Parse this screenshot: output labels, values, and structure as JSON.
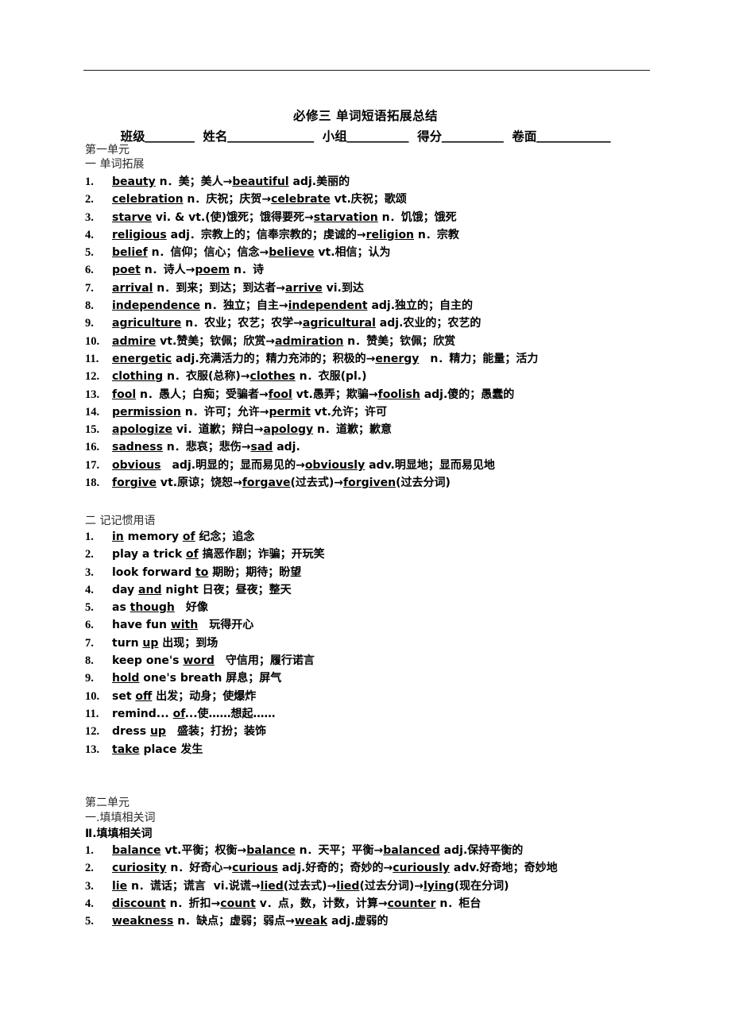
{
  "document": {
    "title": "必修三 单词短语拓展总结",
    "blanks_line": [
      {
        "label": "班级",
        "blank": "＿＿＿＿"
      },
      {
        "label": "姓名",
        "blank": "＿＿＿＿＿＿＿"
      },
      {
        "label": "小组",
        "blank": "＿＿＿＿＿"
      },
      {
        "label": "得分",
        "blank": "＿＿＿＿＿"
      },
      {
        "label": "卷面",
        "blank": "＿＿＿＿＿＿"
      }
    ]
  },
  "unit_one": {
    "heading": "第一单元",
    "section_one_heading": "一 单词拓展",
    "word_items": [
      {
        "n": "1.",
        "parts": [
          {
            "t": "beauty",
            "u": true
          },
          {
            "t": " n．美；美人→",
            "u": false
          },
          {
            "t": "beautiful",
            "u": true
          },
          {
            "t": " adj.美丽的",
            "u": false
          }
        ]
      },
      {
        "n": "2.",
        "parts": [
          {
            "t": "celebration",
            "u": true
          },
          {
            "t": " n．庆祝；庆贺→",
            "u": false
          },
          {
            "t": "celebrate",
            "u": true
          },
          {
            "t": " vt.庆祝；歌颂",
            "u": false
          }
        ]
      },
      {
        "n": "3.",
        "parts": [
          {
            "t": "starve",
            "u": true
          },
          {
            "t": " vi. & vt.(使)饿死；饿得要死→",
            "u": false
          },
          {
            "t": "starvation",
            "u": true
          },
          {
            "t": " n．饥饿；饿死",
            "u": false
          }
        ]
      },
      {
        "n": "4.",
        "parts": [
          {
            "t": "religious",
            "u": true
          },
          {
            "t": " adj．宗教上的；信奉宗教的；虔诚的→",
            "u": false
          },
          {
            "t": "religion",
            "u": true
          },
          {
            "t": " n．宗教",
            "u": false
          }
        ]
      },
      {
        "n": "5.",
        "parts": [
          {
            "t": "belief",
            "u": true
          },
          {
            "t": " n．信仰；信心；信念→",
            "u": false
          },
          {
            "t": "believe",
            "u": true
          },
          {
            "t": " vt.相信；认为",
            "u": false
          }
        ]
      },
      {
        "n": "6.",
        "parts": [
          {
            "t": "poet",
            "u": true
          },
          {
            "t": " n．诗人→",
            "u": false
          },
          {
            "t": "poem",
            "u": true
          },
          {
            "t": " n．诗",
            "u": false
          }
        ]
      },
      {
        "n": "7.",
        "parts": [
          {
            "t": "arrival",
            "u": true
          },
          {
            "t": " n．到来；到达；到达者→",
            "u": false
          },
          {
            "t": "arrive",
            "u": true
          },
          {
            "t": " vi.到达",
            "u": false
          }
        ]
      },
      {
        "n": "8.",
        "parts": [
          {
            "t": "independence",
            "u": true
          },
          {
            "t": " n．独立；自主→",
            "u": false
          },
          {
            "t": "independent",
            "u": true
          },
          {
            "t": " adj.独立的；自主的",
            "u": false
          }
        ]
      },
      {
        "n": "9.",
        "parts": [
          {
            "t": "agriculture",
            "u": true
          },
          {
            "t": " n．农业；农艺；农学→",
            "u": false
          },
          {
            "t": "agricultural",
            "u": true
          },
          {
            "t": " adj.农业的；农艺的",
            "u": false
          }
        ]
      },
      {
        "n": "10.",
        "parts": [
          {
            "t": "admire",
            "u": true
          },
          {
            "t": " vt.赞美；钦佩；欣赏→",
            "u": false
          },
          {
            "t": "admiration",
            "u": true
          },
          {
            "t": " n．赞美；钦佩；欣赏",
            "u": false
          }
        ]
      },
      {
        "n": "11.",
        "parts": [
          {
            "t": "energetic",
            "u": true
          },
          {
            "t": " adj.充满活力的；精力充沛的；积极的→",
            "u": false
          },
          {
            "t": "energy",
            "u": true
          },
          {
            "t": "　n．精力；能量；活力",
            "u": false
          }
        ]
      },
      {
        "n": "12.",
        "parts": [
          {
            "t": "clothing",
            "u": true
          },
          {
            "t": " n．衣服(总称)→",
            "u": false
          },
          {
            "t": "clothes",
            "u": true
          },
          {
            "t": " n．衣服(pl.)",
            "u": false
          }
        ]
      },
      {
        "n": "13.",
        "parts": [
          {
            "t": "fool",
            "u": true
          },
          {
            "t": " n．愚人；白痴；受骗者→",
            "u": false
          },
          {
            "t": "fool",
            "u": true
          },
          {
            "t": " vt.愚弄；欺骗→",
            "u": false
          },
          {
            "t": "foolish",
            "u": true
          },
          {
            "t": " adj.傻的；愚蠢的",
            "u": false
          }
        ]
      },
      {
        "n": "14.",
        "parts": [
          {
            "t": "permission",
            "u": true
          },
          {
            "t": " n．许可；允许→",
            "u": false
          },
          {
            "t": "permit",
            "u": true
          },
          {
            "t": " vt.允许；许可",
            "u": false
          }
        ]
      },
      {
        "n": "15.",
        "parts": [
          {
            "t": "apologize",
            "u": true
          },
          {
            "t": " vi．道歉；辩白→",
            "u": false
          },
          {
            "t": "apology",
            "u": true
          },
          {
            "t": " n．道歉；歉意",
            "u": false
          }
        ]
      },
      {
        "n": "16.",
        "parts": [
          {
            "t": "sadness",
            "u": true
          },
          {
            "t": " n．悲哀；悲伤→",
            "u": false
          },
          {
            "t": "sad",
            "u": true
          },
          {
            "t": " adj.",
            "u": false
          }
        ]
      },
      {
        "n": "17.",
        "parts": [
          {
            "t": "obvious",
            "u": true
          },
          {
            "t": "　adj.明显的；显而易见的→",
            "u": false
          },
          {
            "t": "obviously",
            "u": true
          },
          {
            "t": " adv.明显地；显而易见地",
            "u": false
          }
        ]
      },
      {
        "n": "18.",
        "parts": [
          {
            "t": "forgive",
            "u": true
          },
          {
            "t": " vt.原谅；饶恕→",
            "u": false
          },
          {
            "t": "forgave",
            "u": true
          },
          {
            "t": "(过去式)→",
            "u": false
          },
          {
            "t": "forgiven",
            "u": true
          },
          {
            "t": "(过去分词)",
            "u": false
          }
        ]
      }
    ],
    "section_two_heading": "二 记记惯用语",
    "idiom_items": [
      {
        "n": "1.",
        "parts": [
          {
            "t": "in",
            "u": true
          },
          {
            "t": " memory ",
            "u": false
          },
          {
            "t": "of",
            "u": true
          },
          {
            "t": " 纪念；追念",
            "u": false
          }
        ]
      },
      {
        "n": "2.",
        "parts": [
          {
            "t": "play a trick ",
            "u": false
          },
          {
            "t": "of",
            "u": true
          },
          {
            "t": " 搞恶作剧；诈骗；开玩笑",
            "u": false
          }
        ]
      },
      {
        "n": "3.",
        "parts": [
          {
            "t": "look forward ",
            "u": false
          },
          {
            "t": "to",
            "u": true
          },
          {
            "t": " 期盼；期待；盼望",
            "u": false
          }
        ]
      },
      {
        "n": "4.",
        "parts": [
          {
            "t": "day ",
            "u": false
          },
          {
            "t": "and",
            "u": true
          },
          {
            "t": " night 日夜；昼夜；整天",
            "u": false
          }
        ]
      },
      {
        "n": "5.",
        "parts": [
          {
            "t": "as ",
            "u": false
          },
          {
            "t": "though",
            "u": true
          },
          {
            "t": "　好像",
            "u": false
          }
        ]
      },
      {
        "n": "6.",
        "parts": [
          {
            "t": "have fun ",
            "u": false
          },
          {
            "t": "with",
            "u": true
          },
          {
            "t": "　玩得开心",
            "u": false
          }
        ]
      },
      {
        "n": "7.",
        "parts": [
          {
            "t": "turn ",
            "u": false
          },
          {
            "t": "up",
            "u": true
          },
          {
            "t": " 出现；到场",
            "u": false
          }
        ]
      },
      {
        "n": "8.",
        "parts": [
          {
            "t": "keep one's ",
            "u": false
          },
          {
            "t": "word",
            "u": true
          },
          {
            "t": "　守信用；履行诺言",
            "u": false
          }
        ]
      },
      {
        "n": "9.",
        "parts": [
          {
            "t": "hold",
            "u": true
          },
          {
            "t": " one's breath 屏息；屏气",
            "u": false
          }
        ]
      },
      {
        "n": "10.",
        "parts": [
          {
            "t": "set ",
            "u": false
          },
          {
            "t": "off",
            "u": true
          },
          {
            "t": " 出发；动身；使爆炸",
            "u": false
          }
        ]
      },
      {
        "n": "11.",
        "parts": [
          {
            "t": "remind... ",
            "u": false
          },
          {
            "t": "of",
            "u": true
          },
          {
            "t": "...使……想起……",
            "u": false
          }
        ]
      },
      {
        "n": "12.",
        "parts": [
          {
            "t": "dress ",
            "u": false
          },
          {
            "t": "up",
            "u": true
          },
          {
            "t": "　盛装；打扮；装饰",
            "u": false
          }
        ]
      },
      {
        "n": "13.",
        "parts": [
          {
            "t": "take",
            "u": true
          },
          {
            "t": " place 发生",
            "u": false
          }
        ]
      }
    ]
  },
  "unit_two": {
    "heading": "第二单元",
    "section_one_heading": "一.填填相关词",
    "section_two_heading": "Ⅱ.填填相关词",
    "word_items": [
      {
        "n": "1.",
        "parts": [
          {
            "t": "balance",
            "u": true
          },
          {
            "t": " vt.平衡；权衡→",
            "u": false
          },
          {
            "t": "balance",
            "u": true
          },
          {
            "t": " n．天平；平衡→",
            "u": false
          },
          {
            "t": "balanced",
            "u": true
          },
          {
            "t": " adj.保持平衡的",
            "u": false
          }
        ]
      },
      {
        "n": "2.",
        "parts": [
          {
            "t": "curiosity",
            "u": true
          },
          {
            "t": " n．好奇心→",
            "u": false
          },
          {
            "t": "curious",
            "u": true
          },
          {
            "t": " adj.好奇的；奇妙的→",
            "u": false
          },
          {
            "t": "curiously",
            "u": true
          },
          {
            "t": " adv.好奇地；奇妙地",
            "u": false
          }
        ]
      },
      {
        "n": "3.",
        "parts": [
          {
            "t": "lie",
            "u": true
          },
          {
            "t": " n．谎话；谎言  vi.说谎→",
            "u": false
          },
          {
            "t": "lied",
            "u": true
          },
          {
            "t": "(过去式)→",
            "u": false
          },
          {
            "t": "lied",
            "u": true
          },
          {
            "t": "(过去分词)→",
            "u": false
          },
          {
            "t": "lying",
            "u": true
          },
          {
            "t": "(现在分词)",
            "u": false
          }
        ]
      },
      {
        "n": "4.",
        "parts": [
          {
            "t": "discount",
            "u": true
          },
          {
            "t": " n．折扣→",
            "u": false
          },
          {
            "t": "count",
            "u": true
          },
          {
            "t": " v．点，数，计数，计算→",
            "u": false
          },
          {
            "t": "counter",
            "u": true
          },
          {
            "t": " n．柜台",
            "u": false
          }
        ]
      },
      {
        "n": "5.",
        "parts": [
          {
            "t": "weakness",
            "u": true
          },
          {
            "t": " n．缺点；虚弱；弱点→",
            "u": false
          },
          {
            "t": "weak",
            "u": true
          },
          {
            "t": " adj.虚弱的",
            "u": false
          }
        ]
      }
    ]
  }
}
